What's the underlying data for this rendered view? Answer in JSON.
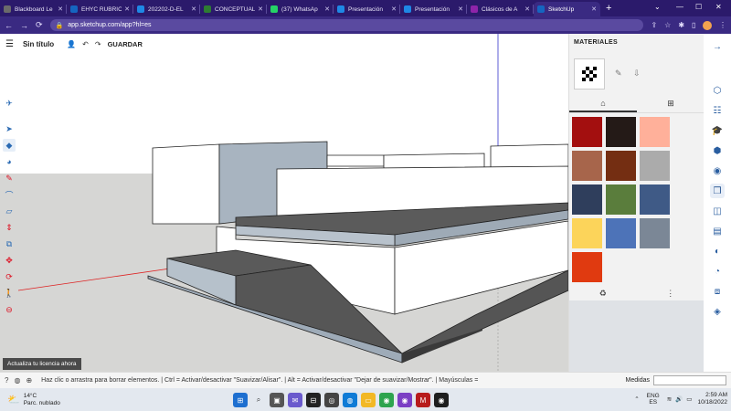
{
  "browser": {
    "tabs": [
      {
        "label": "Blackboard Le",
        "color": "#6b6b6b",
        "active": false
      },
      {
        "label": "EHYC RÚBRIC",
        "color": "#1565c0",
        "active": false
      },
      {
        "label": "202202-D-EL",
        "color": "#1e88e5",
        "active": false
      },
      {
        "label": "CONCEPTUAL",
        "color": "#2e7d32",
        "active": false
      },
      {
        "label": "(37) WhatsAp",
        "color": "#25d366",
        "active": false
      },
      {
        "label": "Presentación",
        "color": "#1e88e5",
        "active": false
      },
      {
        "label": "Presentación",
        "color": "#1e88e5",
        "active": false
      },
      {
        "label": "Clásicos de A",
        "color": "#8e24aa",
        "active": false
      },
      {
        "label": "SketchUp",
        "color": "#1565c0",
        "active": true
      }
    ],
    "url": "app.sketchup.com/app?hl=es"
  },
  "app": {
    "title": "Sin título",
    "save_label": "GUARDAR",
    "license_label": "Actualiza tu licencia ahora"
  },
  "materials": {
    "title": "MATERIALES",
    "swatches": [
      "#a30f0f",
      "#241a17",
      "#ffb09a",
      "#a7654b",
      "#742e12",
      "#ababab",
      "#2f3e5c",
      "#5a7d3c",
      "#3f5a86",
      "#fcd45a",
      "#4d73b8",
      "#7b8796",
      "#e03a10"
    ]
  },
  "status": {
    "message": "Haz clic o arrastra para borrar elementos. | Ctrl = Activar/desactivar \"Suavizar/Alisar\". | Alt = Activar/desactivar \"Dejar de suavizar/Mostrar\". | Mayúsculas =",
    "measures_label": "Medidas"
  },
  "taskbar": {
    "temperature": "14°C",
    "weather": "Parc. nublado",
    "lang_top": "ENG",
    "lang_bottom": "ES",
    "time": "2:59 AM",
    "date": "10/18/2022"
  }
}
